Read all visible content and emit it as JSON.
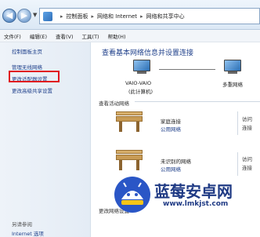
{
  "address_bar": {
    "breadcrumbs": [
      "控制面板",
      "网络和 Internet",
      "网络和共享中心"
    ]
  },
  "menu": [
    "文件(F)",
    "编辑(E)",
    "查看(V)",
    "工具(T)",
    "帮助(H)"
  ],
  "sidebar": {
    "home": "控制面板主页",
    "links": [
      "管理无线网络",
      "更改适配器设置",
      "更改高级共享设置"
    ],
    "see_also": "另请参阅",
    "internet_options": "Internet 选项"
  },
  "main": {
    "title": "查看基本网络信息并设置连接",
    "this_pc_name": "VAIO-VAIO",
    "this_pc_sub": "(此计算机)",
    "network_label": "多重网络",
    "active_networks_heading": "查看活动网络",
    "connections": [
      {
        "name": "家庭连接",
        "type": "公用网络",
        "access": "访问",
        "conn": "连接"
      },
      {
        "name": "未识别的网络",
        "type": "公用网络",
        "access": "访问",
        "conn": "连接"
      }
    ],
    "change_settings_heading": "更改网络设置"
  },
  "watermark": {
    "name": "蓝莓安卓网",
    "url": "www.lmkjst.com"
  },
  "colors": {
    "highlight": "#e0141e",
    "link": "#1e3f8a",
    "sidebar_bg": "#eef3f9"
  }
}
